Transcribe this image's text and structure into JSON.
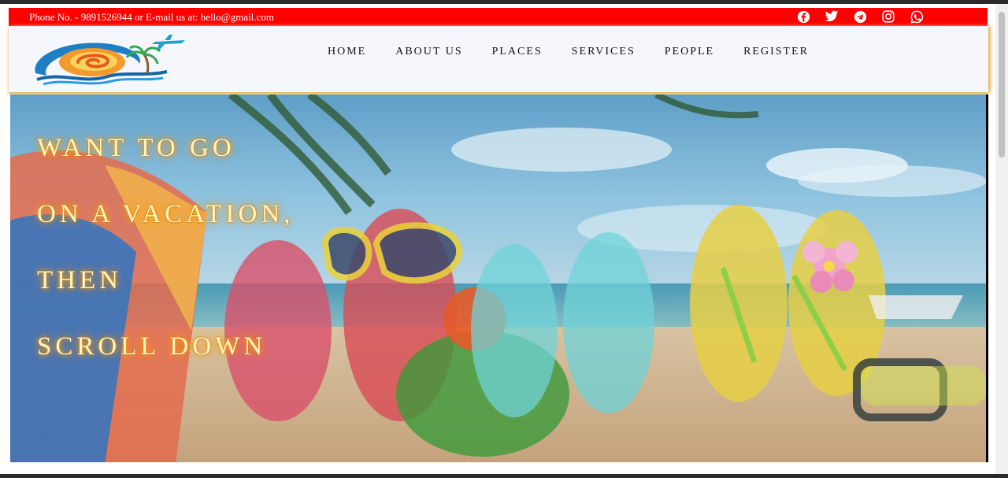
{
  "contact_bar": {
    "text": "Phone No. - 9891526944 or E-mail us at: hello@gmail.com",
    "socials": [
      "facebook-icon",
      "twitter-icon",
      "telegram-icon",
      "instagram-icon",
      "whatsapp-icon"
    ]
  },
  "nav": {
    "items": [
      {
        "label": "HOME"
      },
      {
        "label": "ABOUT US"
      },
      {
        "label": "PLACES"
      },
      {
        "label": "SERVICES"
      },
      {
        "label": "PEOPLE"
      },
      {
        "label": "REGISTER"
      }
    ]
  },
  "hero": {
    "lines": [
      "WANT TO GO",
      "ON A VACATION,",
      "THEN",
      "SCROLL DOWN"
    ]
  },
  "colors": {
    "contact_bar": "#ff0000",
    "navbar_bg": "#f6f7fd",
    "navbar_shadow": "#e8b75c",
    "headline_glow": "#ffb000"
  }
}
